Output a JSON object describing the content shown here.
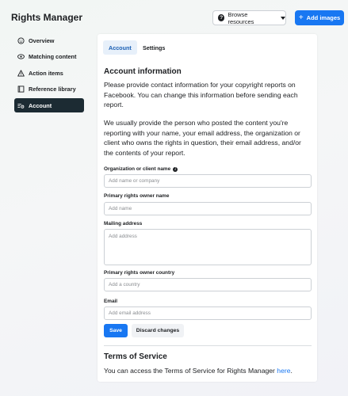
{
  "header": {
    "title": "Rights Manager",
    "browse_label": "Browse resources",
    "add_label": "Add images"
  },
  "sidebar": {
    "items": [
      {
        "label": "Overview",
        "icon": "overview-icon"
      },
      {
        "label": "Matching content",
        "icon": "eye-icon"
      },
      {
        "label": "Action items",
        "icon": "alert-icon"
      },
      {
        "label": "Reference library",
        "icon": "library-icon"
      },
      {
        "label": "Account",
        "icon": "settings-icon",
        "active": true
      }
    ]
  },
  "tabs": [
    {
      "label": "Account",
      "active": true
    },
    {
      "label": "Settings",
      "active": false
    }
  ],
  "account": {
    "heading": "Account information",
    "para1": "Please provide contact information for your copyright reports on Facebook. You can change this information before sending each report.",
    "para2": "We usually provide the person who posted the content you're reporting with your name, your email address, the organization or client who owns the rights in question, their email address, and/or the contents of your report."
  },
  "form": {
    "org_label": "Organization or client name",
    "org_placeholder": "Add name or company",
    "owner_label": "Primary rights owner name",
    "owner_placeholder": "Add name",
    "address_label": "Mailing address",
    "address_placeholder": "Add address",
    "country_label": "Primary rights owner country",
    "country_placeholder": "Add a country",
    "email_label": "Email",
    "email_placeholder": "Add email address",
    "save_label": "Save",
    "discard_label": "Discard changes"
  },
  "terms": {
    "heading": "Terms of Service",
    "text": "You can access the Terms of Service for Rights Manager ",
    "link": "here",
    "suffix": "."
  },
  "colors": {
    "accent": "#1877f2",
    "active_nav": "#1c2b33",
    "tab_active_bg": "#e7f0fa"
  }
}
